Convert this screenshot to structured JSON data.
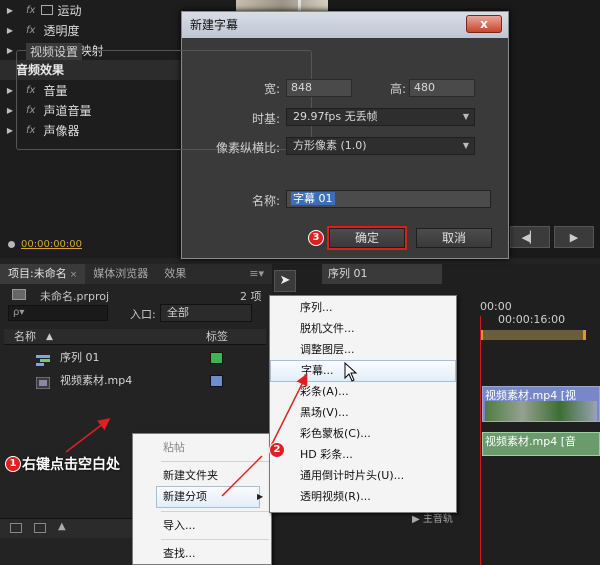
{
  "effects": {
    "rows": [
      {
        "label": "运动",
        "fx": "fx"
      },
      {
        "label": "透明度",
        "fx": "fx"
      },
      {
        "label": "时间重映射",
        "fx": "fx"
      }
    ],
    "audio_header": "音频效果",
    "audio_rows": [
      {
        "label": "音量",
        "fx": "fx"
      },
      {
        "label": "声道音量",
        "fx": "fx"
      },
      {
        "label": "声像器",
        "fx": "fx"
      }
    ],
    "timecode": "00:00:00:00"
  },
  "dialog": {
    "title": "新建字幕",
    "close_label": "x",
    "video_group": "视频设置",
    "width_label": "宽:",
    "width_value": "848",
    "height_label": "高:",
    "height_value": "480",
    "timebase_label": "时基:",
    "timebase_value": "29.97fps 无丢帧",
    "pixel_label": "像素纵横比:",
    "pixel_value": "方形像素 (1.0)",
    "name_label": "名称:",
    "name_value": "字幕 01",
    "ok_label": "确定",
    "cancel_label": "取消"
  },
  "project": {
    "tabs": [
      {
        "label": "项目:未命名",
        "close": "×"
      },
      {
        "label": "媒体浏览器"
      },
      {
        "label": "效果"
      }
    ],
    "file_name": "未命名.prproj",
    "item_count": "2 项",
    "search_placeholder": "ρ▾",
    "entry_label": "入口:",
    "entry_value": "全部",
    "col_name": "名称",
    "col_label": "标签",
    "items": [
      {
        "name": "序列 01",
        "color": "#3fb34f"
      },
      {
        "name": "视频素材.mp4",
        "color": "#6e8fc6"
      }
    ]
  },
  "timeline": {
    "sequence_tab": "序列 01",
    "ruler_start": "00:00",
    "ruler_mark": "00:00:16:00",
    "video_clip": "视频素材.mp4 [视",
    "audio_clip": "视频素材.mp4 [音",
    "track_label": "主音轨"
  },
  "menu1": {
    "paste": "粘帖",
    "new_bin": "新建文件夹",
    "new_item": "新建分项",
    "import": "导入...",
    "find": "查找..."
  },
  "menu2": {
    "items": [
      "序列...",
      "脱机文件...",
      "调整图层...",
      "字幕...",
      "彩条(A)...",
      "黑场(V)...",
      "彩色蒙板(C)...",
      "HD 彩条...",
      "通用倒计时片头(U)...",
      "透明视频(R)..."
    ]
  },
  "annotations": {
    "step1_num": "1",
    "step1_text": "右键点击空白处",
    "step2_num": "2",
    "step3_num": "3"
  },
  "colors": {
    "accent_red": "#e02020",
    "timecode": "#d9a33a",
    "selection": "#3d6fb8"
  }
}
